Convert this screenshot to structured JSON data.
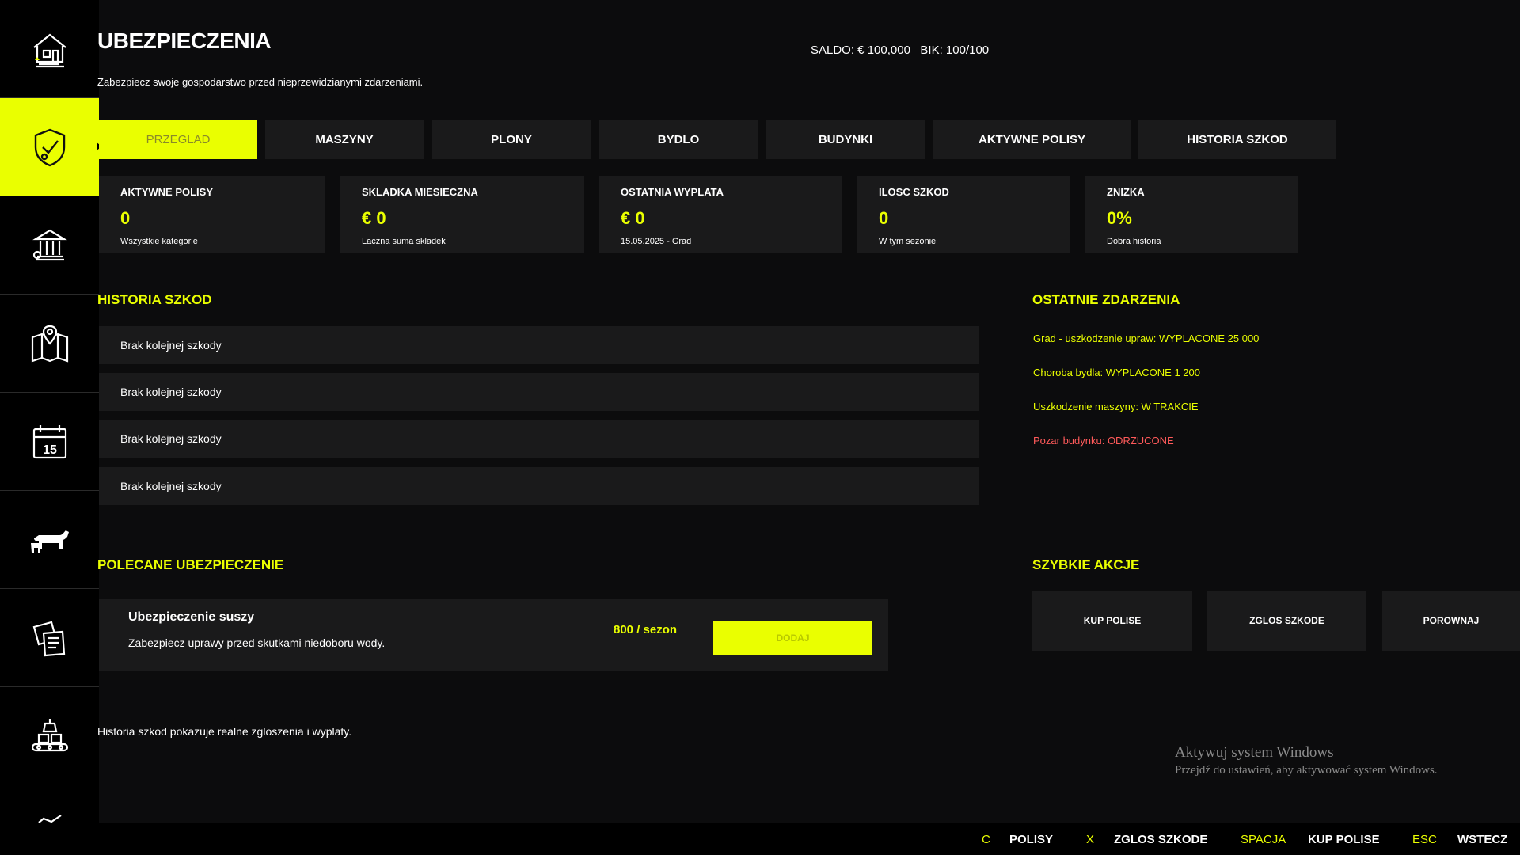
{
  "header": {
    "title": "UBEZPIECZENIA",
    "subtitle": "Zabezpiecz swoje gospodarstwo przed nieprzewidzianymi zdarzeniami.",
    "saldo": "SALDO: € 100,000   BIK: 100/100"
  },
  "sidebar": {
    "items": [
      {
        "icon": "farm-house-icon"
      },
      {
        "icon": "shield-check-icon",
        "active": true
      },
      {
        "icon": "bank-icon"
      },
      {
        "icon": "map-icon"
      },
      {
        "icon": "calendar-icon",
        "day": "15"
      },
      {
        "icon": "animals-icon"
      },
      {
        "icon": "documents-icon"
      },
      {
        "icon": "production-icon"
      },
      {
        "icon": "more-icon"
      }
    ]
  },
  "tabs": [
    "PRZEGLAD",
    "MASZYNY",
    "PLONY",
    "BYDLO",
    "BUDYNKI",
    "AKTYWNE POLISY",
    "HISTORIA SZKOD"
  ],
  "stats": [
    {
      "title": "AKTYWNE POLISY",
      "value": "0",
      "sub": "Wszystkie kategorie"
    },
    {
      "title": "SKLADKA MIESIECZNA",
      "value": "€ 0",
      "sub": "Laczna suma skladek"
    },
    {
      "title": "OSTATNIA WYPLATA",
      "value": "€ 0",
      "sub": "15.05.2025 - Grad"
    },
    {
      "title": "ILOSC SZKOD",
      "value": "0",
      "sub": "W tym sezonie"
    },
    {
      "title": "ZNIZKA",
      "value": "0%",
      "sub": "Dobra historia"
    }
  ],
  "history": {
    "title": "HISTORIA SZKOD",
    "rows": [
      "Brak kolejnej szkody",
      "Brak kolejnej szkody",
      "Brak kolejnej szkody",
      "Brak kolejnej szkody"
    ]
  },
  "events": {
    "title": "OSTATNIE ZDARZENIA",
    "items": [
      "Grad - uszkodzenie upraw: WYPLACONE 25 000",
      "Choroba bydla: WYPLACONE 1 200",
      "Uszkodzenie maszyny: W TRAKCIE",
      "Pozar budynku: ODRZUCONE"
    ]
  },
  "recommended": {
    "title": "POLECANE UBEZPIECZENIE",
    "name": "Ubezpieczenie suszy",
    "description": "Zabezpiecz uprawy przed skutkami niedoboru wody.",
    "price": "800 / sezon",
    "button": "DODAJ"
  },
  "quick_actions": {
    "title": "SZYBKIE AKCJE",
    "buttons": [
      "KUP POLISE",
      "ZGLOS SZKODE",
      "POROWNAJ"
    ]
  },
  "footnote": "Historia szkod pokazuje realne zgloszenia i wyplaty.",
  "watermark": {
    "line1": "Aktywuj system Windows",
    "line2": "Przejdź do ustawień, aby aktywować system Windows."
  },
  "hotkeys": [
    {
      "key": "C",
      "label": "POLISY"
    },
    {
      "key": "X",
      "label": "ZGLOS SZKODE"
    },
    {
      "key": "SPACJA",
      "label": "KUP POLISE"
    },
    {
      "key": "ESC",
      "label": "WSTECZ"
    }
  ],
  "colors": {
    "accent": "#eaff00",
    "background": "#0c0c0d",
    "panel": "#1a1a1b",
    "danger": "#ff5a5a"
  }
}
